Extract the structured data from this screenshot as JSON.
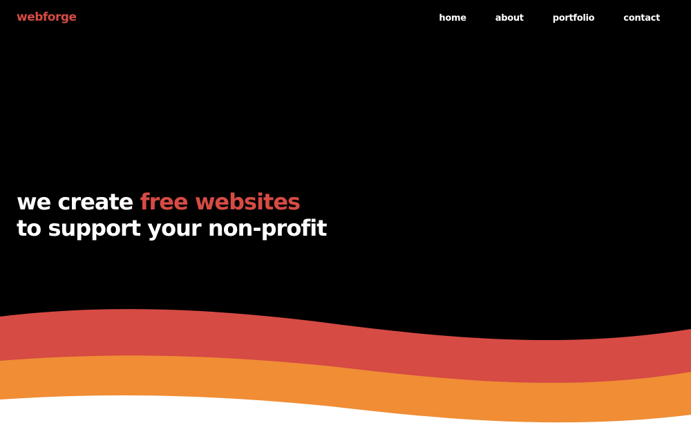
{
  "header": {
    "brand": "webforge",
    "nav": [
      {
        "label": "home"
      },
      {
        "label": "about"
      },
      {
        "label": "portfolio"
      },
      {
        "label": "contact"
      }
    ]
  },
  "hero": {
    "line1_prefix": "we create",
    "line1_highlight": "free websites",
    "line2": "to support your non-profit"
  },
  "colors": {
    "background": "#000000",
    "accent": "#d64b44",
    "orange": "#f08d35",
    "text": "#ffffff"
  }
}
